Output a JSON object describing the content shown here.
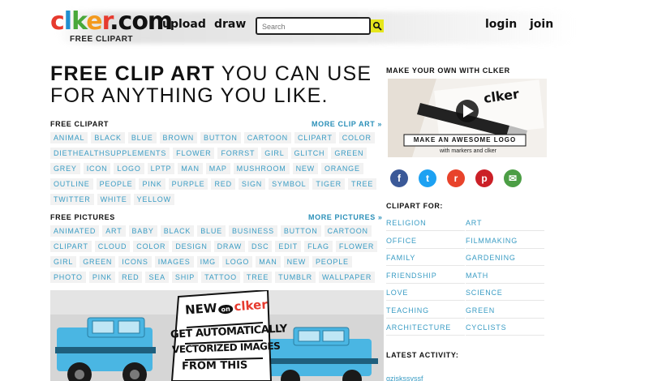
{
  "header": {
    "logo_text": "clker.com",
    "logo_sub": "FREE CLIPART",
    "nav_upload": "upload",
    "nav_draw": "draw",
    "search_placeholder": "Search",
    "nav_login": "login",
    "nav_join": "join"
  },
  "hero": {
    "bold": "FREE CLIP ART",
    "line1_rest": " YOU CAN USE",
    "line2": "FOR ANYTHING YOU LIKE."
  },
  "free_clipart": {
    "title": "FREE CLIPART",
    "more": "MORE CLIP ART »",
    "tags": [
      "ANIMAL",
      "BLACK",
      "BLUE",
      "BROWN",
      "BUTTON",
      "CARTOON",
      "CLIPART",
      "COLOR",
      "DIETHEALTHSUPPLEMENTS",
      "FLOWER",
      "FORRST",
      "GIRL",
      "GLITCH",
      "GREEN",
      "GREY",
      "ICON",
      "LOGO",
      "LPTP",
      "MAN",
      "MAP",
      "MUSHROOM",
      "NEW",
      "ORANGE",
      "OUTLINE",
      "PEOPLE",
      "PINK",
      "PURPLE",
      "RED",
      "SIGN",
      "SYMBOL",
      "TIGER",
      "TREE",
      "TWITTER",
      "WHITE",
      "YELLOW"
    ]
  },
  "free_pictures": {
    "title": "FREE PICTURES",
    "more": "MORE PICTURES »",
    "tags": [
      "ANIMATED",
      "ART",
      "BABY",
      "BLACK",
      "BLUE",
      "BUSINESS",
      "BUTTON",
      "CARTOON",
      "CLIPART",
      "CLOUD",
      "COLOR",
      "DESIGN",
      "DRAW",
      "DSC",
      "EDIT",
      "FLAG",
      "FLOWER",
      "GIRL",
      "GREEN",
      "ICONS",
      "IMAGES",
      "IMG",
      "LOGO",
      "MAN",
      "NEW",
      "PEOPLE",
      "PHOTO",
      "PINK",
      "RED",
      "SEA",
      "SHIP",
      "TATTOO",
      "TREE",
      "TUMBLR",
      "WALLPAPER"
    ]
  },
  "banner": {
    "line1": "NEW",
    "line1_small": "on",
    "line1_brand": "clker",
    "line2": "GET AUTOMATICALLY",
    "line3": "VECTORIZED IMAGES",
    "line4": "FROM THIS"
  },
  "right": {
    "make_title": "MAKE YOUR OWN WITH CLKER",
    "video_caption": "MAKE AN AWESOME LOGO",
    "video_sub": "with markers and clker",
    "video_brand": "clker",
    "share": [
      {
        "name": "facebook-icon",
        "glyph": "f",
        "color": "#3b5998"
      },
      {
        "name": "twitter-icon",
        "glyph": "t",
        "color": "#1da1f2"
      },
      {
        "name": "reddit-icon",
        "glyph": "r",
        "color": "#e8432b"
      },
      {
        "name": "pinterest-icon",
        "glyph": "p",
        "color": "#cb2027"
      },
      {
        "name": "email-icon",
        "glyph": "✉",
        "color": "#4c9e45"
      }
    ],
    "clipart_for_title": "CLIPART FOR:",
    "clipart_for": [
      "RELIGION",
      "ART",
      "OFFICE",
      "FILMMAKING",
      "FAMILY",
      "GARDENING",
      "FRIENDSHIP",
      "MATH",
      "LOVE",
      "SCIENCE",
      "TEACHING",
      "GREEN",
      "ARCHITECTURE",
      "CYCLISTS"
    ],
    "latest_title": "LATEST ACTIVITY:",
    "latest_item": "gziskssyssf"
  },
  "colors": {
    "link_blue": "#3a9cc4",
    "tag_bg": "#f2f2f2",
    "search_button": "#e6e61c",
    "logo_red": "#e63a2e",
    "logo_blue": "#1f8fd0",
    "logo_green": "#49a83a",
    "logo_orange": "#f39a1e",
    "jeep_blue": "#4ab6e3"
  }
}
